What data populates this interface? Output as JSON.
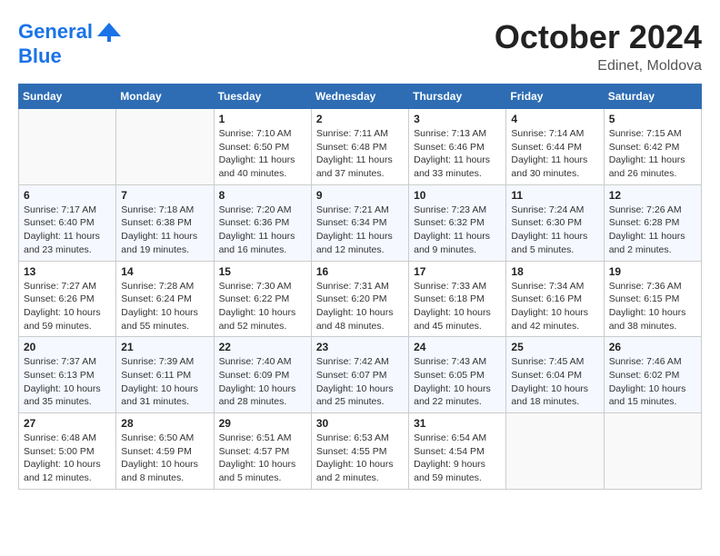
{
  "header": {
    "logo_line1": "General",
    "logo_line2": "Blue",
    "month_year": "October 2024",
    "location": "Edinet, Moldova"
  },
  "weekdays": [
    "Sunday",
    "Monday",
    "Tuesday",
    "Wednesday",
    "Thursday",
    "Friday",
    "Saturday"
  ],
  "weeks": [
    [
      {
        "day": "",
        "info": ""
      },
      {
        "day": "",
        "info": ""
      },
      {
        "day": "1",
        "info": "Sunrise: 7:10 AM\nSunset: 6:50 PM\nDaylight: 11 hours and 40 minutes."
      },
      {
        "day": "2",
        "info": "Sunrise: 7:11 AM\nSunset: 6:48 PM\nDaylight: 11 hours and 37 minutes."
      },
      {
        "day": "3",
        "info": "Sunrise: 7:13 AM\nSunset: 6:46 PM\nDaylight: 11 hours and 33 minutes."
      },
      {
        "day": "4",
        "info": "Sunrise: 7:14 AM\nSunset: 6:44 PM\nDaylight: 11 hours and 30 minutes."
      },
      {
        "day": "5",
        "info": "Sunrise: 7:15 AM\nSunset: 6:42 PM\nDaylight: 11 hours and 26 minutes."
      }
    ],
    [
      {
        "day": "6",
        "info": "Sunrise: 7:17 AM\nSunset: 6:40 PM\nDaylight: 11 hours and 23 minutes."
      },
      {
        "day": "7",
        "info": "Sunrise: 7:18 AM\nSunset: 6:38 PM\nDaylight: 11 hours and 19 minutes."
      },
      {
        "day": "8",
        "info": "Sunrise: 7:20 AM\nSunset: 6:36 PM\nDaylight: 11 hours and 16 minutes."
      },
      {
        "day": "9",
        "info": "Sunrise: 7:21 AM\nSunset: 6:34 PM\nDaylight: 11 hours and 12 minutes."
      },
      {
        "day": "10",
        "info": "Sunrise: 7:23 AM\nSunset: 6:32 PM\nDaylight: 11 hours and 9 minutes."
      },
      {
        "day": "11",
        "info": "Sunrise: 7:24 AM\nSunset: 6:30 PM\nDaylight: 11 hours and 5 minutes."
      },
      {
        "day": "12",
        "info": "Sunrise: 7:26 AM\nSunset: 6:28 PM\nDaylight: 11 hours and 2 minutes."
      }
    ],
    [
      {
        "day": "13",
        "info": "Sunrise: 7:27 AM\nSunset: 6:26 PM\nDaylight: 10 hours and 59 minutes."
      },
      {
        "day": "14",
        "info": "Sunrise: 7:28 AM\nSunset: 6:24 PM\nDaylight: 10 hours and 55 minutes."
      },
      {
        "day": "15",
        "info": "Sunrise: 7:30 AM\nSunset: 6:22 PM\nDaylight: 10 hours and 52 minutes."
      },
      {
        "day": "16",
        "info": "Sunrise: 7:31 AM\nSunset: 6:20 PM\nDaylight: 10 hours and 48 minutes."
      },
      {
        "day": "17",
        "info": "Sunrise: 7:33 AM\nSunset: 6:18 PM\nDaylight: 10 hours and 45 minutes."
      },
      {
        "day": "18",
        "info": "Sunrise: 7:34 AM\nSunset: 6:16 PM\nDaylight: 10 hours and 42 minutes."
      },
      {
        "day": "19",
        "info": "Sunrise: 7:36 AM\nSunset: 6:15 PM\nDaylight: 10 hours and 38 minutes."
      }
    ],
    [
      {
        "day": "20",
        "info": "Sunrise: 7:37 AM\nSunset: 6:13 PM\nDaylight: 10 hours and 35 minutes."
      },
      {
        "day": "21",
        "info": "Sunrise: 7:39 AM\nSunset: 6:11 PM\nDaylight: 10 hours and 31 minutes."
      },
      {
        "day": "22",
        "info": "Sunrise: 7:40 AM\nSunset: 6:09 PM\nDaylight: 10 hours and 28 minutes."
      },
      {
        "day": "23",
        "info": "Sunrise: 7:42 AM\nSunset: 6:07 PM\nDaylight: 10 hours and 25 minutes."
      },
      {
        "day": "24",
        "info": "Sunrise: 7:43 AM\nSunset: 6:05 PM\nDaylight: 10 hours and 22 minutes."
      },
      {
        "day": "25",
        "info": "Sunrise: 7:45 AM\nSunset: 6:04 PM\nDaylight: 10 hours and 18 minutes."
      },
      {
        "day": "26",
        "info": "Sunrise: 7:46 AM\nSunset: 6:02 PM\nDaylight: 10 hours and 15 minutes."
      }
    ],
    [
      {
        "day": "27",
        "info": "Sunrise: 6:48 AM\nSunset: 5:00 PM\nDaylight: 10 hours and 12 minutes."
      },
      {
        "day": "28",
        "info": "Sunrise: 6:50 AM\nSunset: 4:59 PM\nDaylight: 10 hours and 8 minutes."
      },
      {
        "day": "29",
        "info": "Sunrise: 6:51 AM\nSunset: 4:57 PM\nDaylight: 10 hours and 5 minutes."
      },
      {
        "day": "30",
        "info": "Sunrise: 6:53 AM\nSunset: 4:55 PM\nDaylight: 10 hours and 2 minutes."
      },
      {
        "day": "31",
        "info": "Sunrise: 6:54 AM\nSunset: 4:54 PM\nDaylight: 9 hours and 59 minutes."
      },
      {
        "day": "",
        "info": ""
      },
      {
        "day": "",
        "info": ""
      }
    ]
  ]
}
